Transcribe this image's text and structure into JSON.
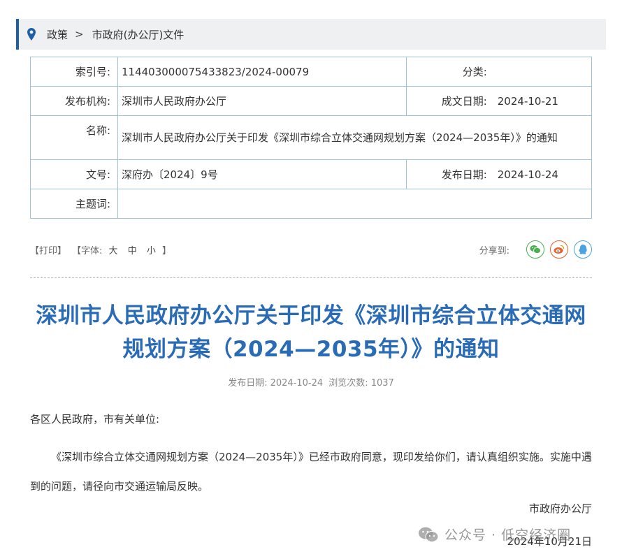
{
  "breadcrumb": {
    "items": [
      "政策",
      "市政府(办公厅)文件"
    ],
    "separator": ">"
  },
  "meta": {
    "index_label": "索引号:",
    "index_value": "114403000075433823/2024-00079",
    "category_label": "分类:",
    "category_value": "",
    "publisher_label": "发布机构:",
    "publisher_value": "深圳市人民政府办公厅",
    "created_label": "成文日期:",
    "created_value": "2024-10-21",
    "name_label": "名称:",
    "name_value": "深圳市人民政府办公厅关于印发《深圳市综合立体交通网规划方案（2024—2035年）》的通知",
    "docno_label": "文号:",
    "docno_value": "深府办〔2024〕9号",
    "pubdate_label": "发布日期:",
    "pubdate_value": "2024-10-24",
    "keywords_label": "主题词:",
    "keywords_value": ""
  },
  "toolbar": {
    "print": "【打印】",
    "font_open": "【字体:",
    "size_large": "大",
    "size_medium": "中",
    "size_small": "小",
    "font_close": "】",
    "share_label": "分享到:",
    "share_icons": [
      "wechat-icon",
      "weibo-icon",
      "qq-icon"
    ]
  },
  "article": {
    "title": "深圳市人民政府办公厅关于印发《深圳市综合立体交通网规划方案（2024—2035年）》的通知",
    "pubinfo_date_label": "发布日期:",
    "pubinfo_date": "2024-10-24",
    "pubinfo_views_label": "浏览次数:",
    "pubinfo_views": "1037",
    "salutation": "各区人民政府，市有关单位:",
    "paragraph": "《深圳市综合立体交通网规划方案（2024—2035年）》已经市政府同意，现印发给你们，请认真组织实施。实施中遇到的问题，请径向市交通运输局反映。",
    "signature": "市政府办公厅",
    "date": "2024年10月21日"
  },
  "watermark": {
    "text": "公众号 · 低空经济圈"
  },
  "colors": {
    "accent": "#1f5fa6",
    "title": "#2a6bb5",
    "table_border": "#9fc2d9",
    "breadcrumb_bg": "#eef0f2"
  }
}
